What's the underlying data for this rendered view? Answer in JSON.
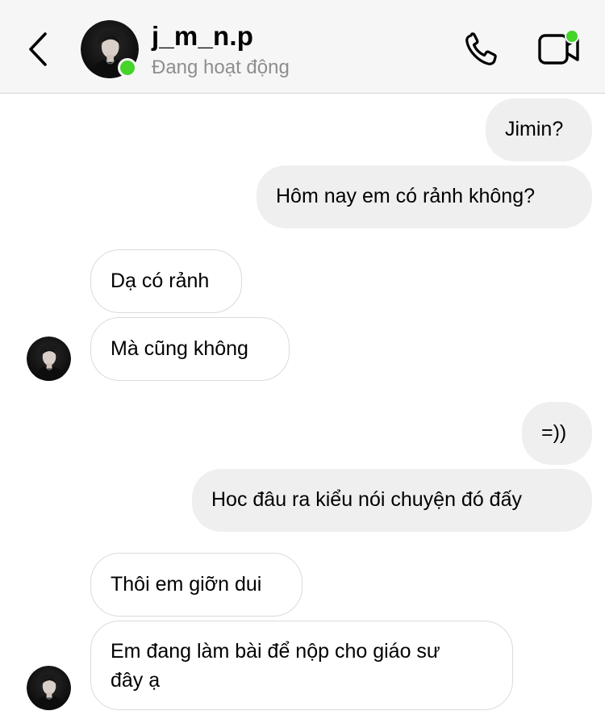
{
  "header": {
    "username": "j_m_n.p",
    "status": "Đang hoạt động",
    "back_icon": "chevron-left-icon",
    "call_icon": "phone-icon",
    "video_icon": "video-camera-icon",
    "online_color": "#44d42a"
  },
  "messages": [
    {
      "direction": "outgoing",
      "text": "Jimin?"
    },
    {
      "direction": "outgoing",
      "text": "Hôm nay em có rảnh không?"
    },
    {
      "direction": "incoming",
      "text": "Dạ có rảnh"
    },
    {
      "direction": "incoming",
      "text": "Mà cũng không"
    },
    {
      "direction": "outgoing",
      "text": "=))"
    },
    {
      "direction": "outgoing",
      "text": "Hoc đâu ra kiểu nói chuyện đó đấy"
    },
    {
      "direction": "incoming",
      "text": "Thôi em giỡn dui"
    },
    {
      "direction": "incoming",
      "lines": [
        "Em đang làm bài để nộp cho giáo sư",
        "đây ạ"
      ]
    }
  ],
  "colors": {
    "outgoing_bubble": "#efefef",
    "incoming_border": "#dbdbdb",
    "secondary_text": "#8e8e8e"
  }
}
